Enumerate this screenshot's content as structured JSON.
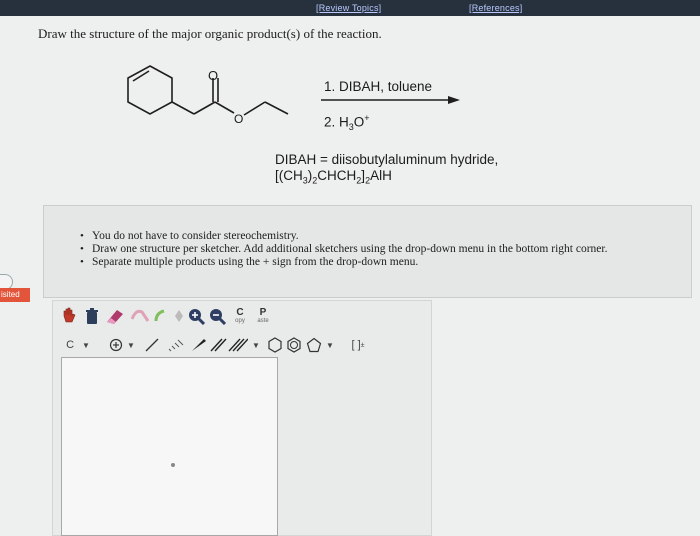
{
  "header": {
    "review_topics": "[Review Topics]",
    "references": "[References]"
  },
  "question": "Draw the structure of the major organic product(s) of the reaction.",
  "reaction": {
    "step1": "1. DIBAH, toluene",
    "step2_prefix": "2. H",
    "step2_sub": "3",
    "step2_o": "O",
    "step2_sup": "+",
    "atom_o_carbonyl": "O",
    "atom_o_ester": "O"
  },
  "dibah": {
    "line1": "DIBAH = diisobutylaluminum hydride,",
    "line2_a": "[(CH",
    "line2_sub1": "3",
    "line2_b": ")",
    "line2_sub2": "2",
    "line2_c": "CHCH",
    "line2_sub3": "2",
    "line2_d": "]",
    "line2_sub4": "2",
    "line2_e": "AlH"
  },
  "instructions": [
    "You do not have to consider stereochemistry.",
    "Draw one structure per sketcher. Add additional sketchers using the drop-down menu in the bottom right corner.",
    "Separate multiple products using the + sign from the drop-down menu."
  ],
  "sidebar": {
    "visited_label": "isited"
  },
  "toolbar": {
    "copy_letter": "C",
    "copy_label": "opy",
    "paste_letter": "P",
    "paste_label": "aste",
    "atom_selector": "C",
    "bracket_label": "[ ]",
    "charge_sup": "±"
  },
  "colors": {
    "topbar": "#26313d",
    "link": "#b9c9ff",
    "visited_badge": "#e2553a",
    "help_icon": "#3d8b4e"
  }
}
